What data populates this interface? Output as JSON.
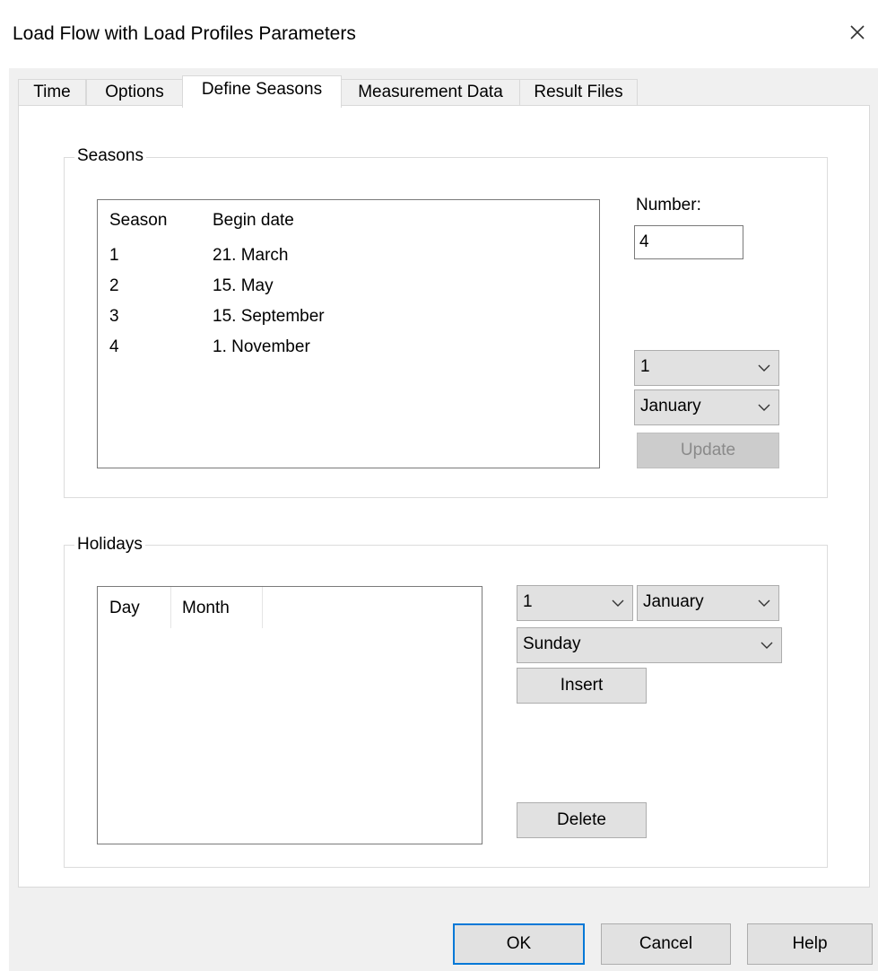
{
  "window": {
    "title": "Load Flow with Load Profiles Parameters",
    "close_icon": "close-icon"
  },
  "tabs": [
    {
      "label": "Time",
      "active": false
    },
    {
      "label": "Options",
      "active": false
    },
    {
      "label": "Define Seasons",
      "active": true
    },
    {
      "label": "Measurement Data",
      "active": false
    },
    {
      "label": "Result Files",
      "active": false
    }
  ],
  "seasons": {
    "group_label": "Seasons",
    "columns": [
      "Season",
      "Begin date"
    ],
    "rows": [
      {
        "season": "1",
        "begin_date": "21. March"
      },
      {
        "season": "2",
        "begin_date": "15. May"
      },
      {
        "season": "3",
        "begin_date": "15. September"
      },
      {
        "season": "4",
        "begin_date": "1. November"
      }
    ],
    "number_label": "Number:",
    "number_value": "4",
    "day_select": "1",
    "month_select": "January",
    "update_label": "Update"
  },
  "holidays": {
    "group_label": "Holidays",
    "columns": [
      "Day",
      "Month"
    ],
    "day_select": "1",
    "month_select": "January",
    "weekday_select": "Sunday",
    "insert_label": "Insert",
    "delete_label": "Delete"
  },
  "footer": {
    "ok_label": "OK",
    "cancel_label": "Cancel",
    "help_label": "Help"
  },
  "colors": {
    "dialog_bg": "#f0f0f0",
    "panel_bg": "#ffffff",
    "button_bg": "#e1e1e1",
    "default_button_border": "#0078d7",
    "disabled_text": "#8a8a8a"
  }
}
